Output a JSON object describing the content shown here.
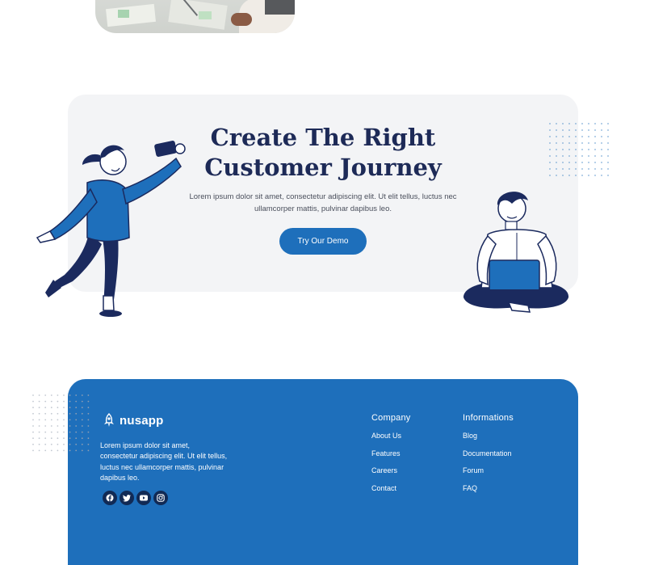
{
  "hero": {
    "title_line1": "Create The Right",
    "title_line2": "Customer Journey",
    "description": "Lorem ipsum dolor sit amet, consectetur adipiscing elit. Ut elit tellus, luctus nec ullamcorper mattis, pulvinar dapibus leo.",
    "button_label": "Try Our Demo"
  },
  "footer": {
    "brand": "nusapp",
    "description": "Lorem ipsum dolor sit amet, consectetur adipiscing elit. Ut elit tellus, luctus nec ullamcorper mattis, pulvinar dapibus leo.",
    "socials": [
      "facebook-icon",
      "twitter-icon",
      "youtube-icon",
      "instagram-icon"
    ],
    "company": {
      "heading": "Company",
      "links": [
        "About Us",
        "Features",
        "Careers",
        "Contact"
      ]
    },
    "informations": {
      "heading": "Informations",
      "links": [
        "Blog",
        "Documentation",
        "Forum",
        "FAQ"
      ]
    }
  },
  "colors": {
    "primary": "#1e6fbb",
    "navy": "#1d2a57",
    "card_bg": "#f3f4f6"
  }
}
